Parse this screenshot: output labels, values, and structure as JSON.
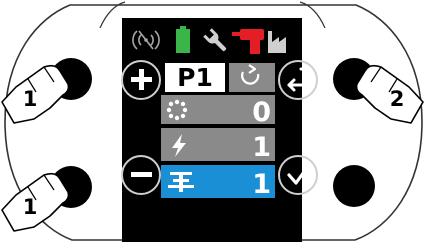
{
  "colors": {
    "background": "#ffffff",
    "bezel_outline": "#333333",
    "screen": "#000000",
    "row": "#8a8a8a",
    "row_selected": "#1a8fd6",
    "text": "#ffffff",
    "signal_icon": "#a7a7a7",
    "battery_icon": "#39b54a",
    "wrench_icon": "#cfcfcf",
    "drill_icon": "#e31e24",
    "factory_icon": "#cfcfcf"
  },
  "status_bar": {
    "icons": [
      "no-signal-icon",
      "battery-icon",
      "wrench-icon",
      "drill-icon",
      "factory-icon"
    ]
  },
  "program": {
    "label": "P1",
    "mode_icon": "rotation-icon"
  },
  "rows": [
    {
      "icon": "speed-dots-icon",
      "value": "0",
      "selected": false
    },
    {
      "icon": "lightning-icon",
      "value": "1",
      "selected": false
    },
    {
      "icon": "anchor-icon",
      "value": "1",
      "selected": true
    }
  ],
  "side_controls": {
    "left_top": "plus-icon",
    "left_bottom": "minus-icon",
    "right_top": "return-icon",
    "right_bottom": "checkmark-icon"
  },
  "callouts": {
    "top_left": "1",
    "bottom_left": "1",
    "top_right": "2"
  }
}
